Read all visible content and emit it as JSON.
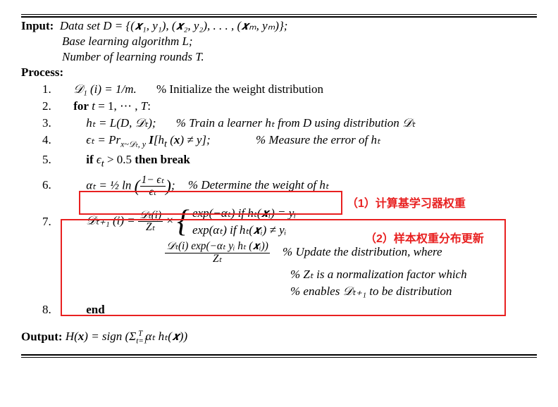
{
  "header": {
    "input_label": "Input:",
    "dataset": "Data set D = {(𝒙₁, y₁), (𝒙₂, y₂), . . . , (𝒙ₘ, yₘ)};",
    "base_learner": "Base learning algorithm L;",
    "rounds": "Number of learning rounds T."
  },
  "process_label": "Process:",
  "steps": {
    "s1_num": "1.",
    "s1_body": "𝒟₁ (i) = 1/m.",
    "s1_comment": "% Initialize the weight distribution",
    "s2_num": "2.",
    "s2_body": "for t = 1, ⋯ , T:",
    "s3_num": "3.",
    "s3_body": "hₜ = L(D, 𝒟ₜ);",
    "s3_comment": "% Train a learner hₜ from D using distribution 𝒟ₜ",
    "s4_num": "4.",
    "s4_body_pre": "ϵₜ = Pr",
    "s4_sub": "x~𝒟ₜ, y",
    "s4_body_post": " I[hₜ (𝒙) ≠ y];",
    "s4_comment": "% Measure the error of hₜ",
    "s5_num": "5.",
    "s5_body": "if ϵₜ > 0.5 then break",
    "s6_num": "6.",
    "s6_pre": "αₜ = ½ ln ",
    "s6_frac_n": "1− ϵₜ",
    "s6_frac_d": "ϵₜ",
    "s6_comment": "% Determine the weight of hₜ",
    "s7_num": "7.",
    "s7_lhs": "𝒟ₜ₊₁ (i) = ",
    "s7_frac1_n": "𝒟ₜ(i)",
    "s7_frac1_d": "Zₜ",
    "s7_mult": " × ",
    "s7_case1": "exp(−αₜ) if hₜ(𝒙ᵢ) = yᵢ",
    "s7_case2": "exp(αₜ)   if hₜ(𝒙ᵢ) ≠ yᵢ",
    "s7_frac2_n": "𝒟ₜ(i) exp(−αₜ yᵢ hₜ (𝒙ᵢ))",
    "s7_frac2_d": "Zₜ",
    "s7_c1": "% Update the distribution, where",
    "s7_c2": "% Zₜ is a normalization factor which",
    "s7_c3": "% enables 𝒟ₜ₊₁ to be distribution",
    "s8_num": "8.",
    "s8_body": "end"
  },
  "output": {
    "label": "Output:",
    "body_pre": "H(𝒙) = sign (Σ",
    "sum_limits": "t=1",
    "sum_upper": "T",
    "body_post": " αₜ hₜ(𝒙))"
  },
  "annotations": {
    "a1": "（1）计算基学习器权重",
    "a2": "（2）样本权重分布更新"
  }
}
